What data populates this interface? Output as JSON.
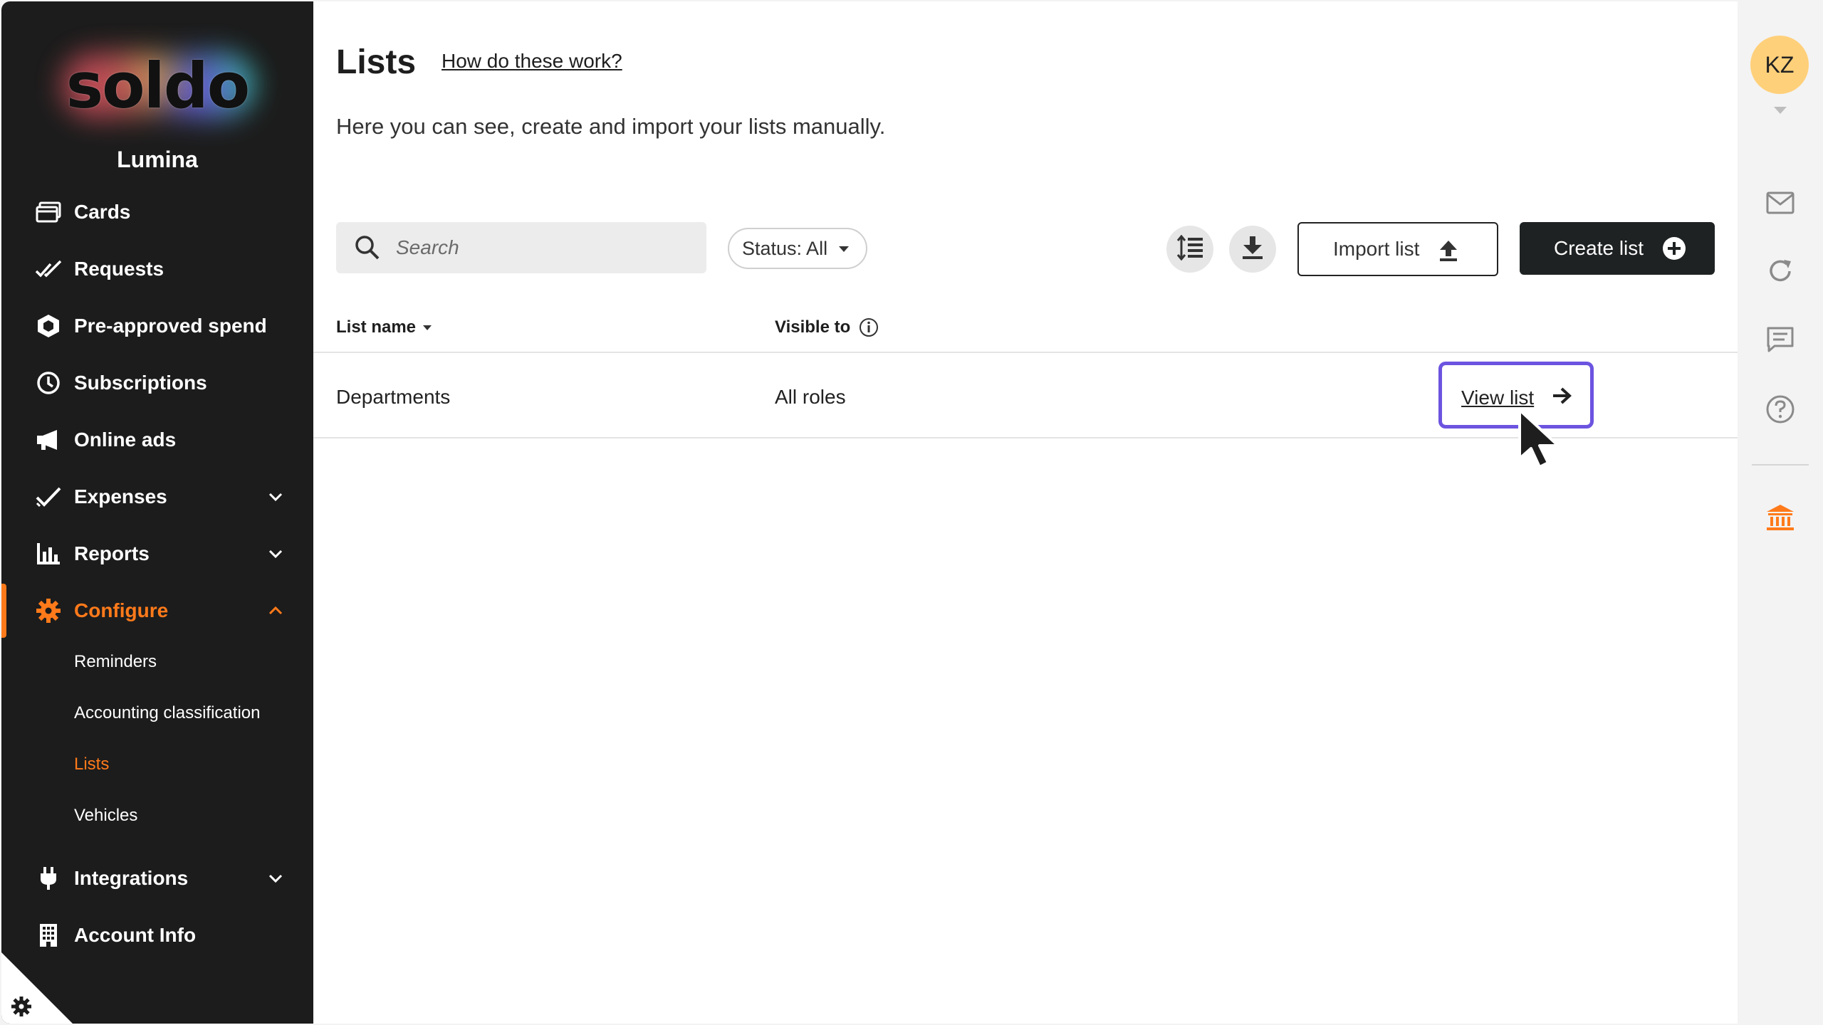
{
  "sidebar": {
    "logo_text": "soldo",
    "company": "Lumina",
    "items": [
      {
        "label": "Cards",
        "icon": "card-icon"
      },
      {
        "label": "Requests",
        "icon": "check-double-icon"
      },
      {
        "label": "Pre-approved spend",
        "icon": "hexagon-icon"
      },
      {
        "label": "Subscriptions",
        "icon": "clock-icon"
      },
      {
        "label": "Online ads",
        "icon": "megaphone-icon"
      },
      {
        "label": "Expenses",
        "icon": "check-icon"
      },
      {
        "label": "Reports",
        "icon": "bar-chart-icon"
      },
      {
        "label": "Configure",
        "icon": "gear-icon"
      },
      {
        "label": "Integrations",
        "icon": "plug-icon"
      },
      {
        "label": "Account Info",
        "icon": "building-icon"
      }
    ],
    "configure_sub": [
      "Reminders",
      "Accounting classification",
      "Lists",
      "Vehicles"
    ],
    "active_color": "#ff7a1a"
  },
  "page": {
    "title": "Lists",
    "help_link": "How do these work?",
    "subtitle": "Here you can see, create and import your lists manually."
  },
  "toolbar": {
    "search_placeholder": "Search",
    "status_label": "Status: All",
    "import_label": "Import list",
    "create_label": "Create list"
  },
  "table": {
    "headers": [
      "List name",
      "Visible to"
    ],
    "rows": [
      {
        "name": "Departments",
        "visible_to": "All roles",
        "action": "View list"
      }
    ]
  },
  "rail": {
    "avatar_initials": "KZ",
    "icons": [
      "mail-icon",
      "refresh-icon",
      "chat-icon",
      "help-icon",
      "bank-icon"
    ]
  },
  "colors": {
    "accent": "#ff7a1a",
    "focus_ring": "#6c54e0",
    "sidebar_bg": "#1c1c1c",
    "primary_button": "#1f2222"
  }
}
